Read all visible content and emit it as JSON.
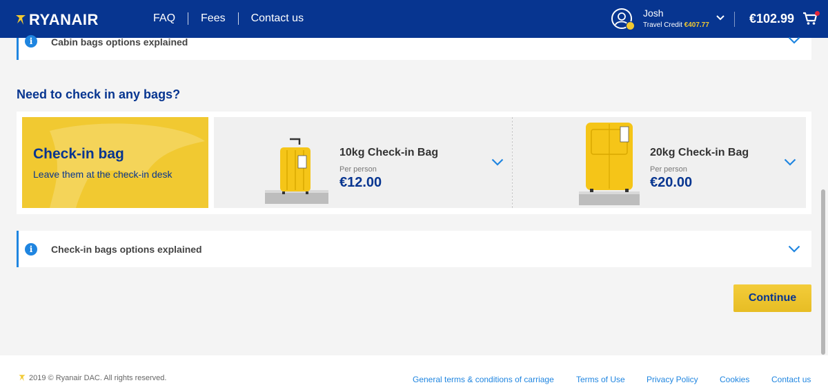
{
  "header": {
    "brand": "RYANAIR",
    "nav": {
      "faq": "FAQ",
      "fees": "Fees",
      "contact": "Contact us"
    },
    "user": {
      "name": "Josh",
      "credit_label": "Travel Credit",
      "credit_amount": "€407.77"
    },
    "total": "€102.99"
  },
  "cabin_panel": {
    "label": "Cabin bags options explained"
  },
  "checkin_section": {
    "title": "Need to check in any bags?",
    "promo": {
      "title": "Check-in bag",
      "subtitle": "Leave them at the check-in desk"
    },
    "options": [
      {
        "name": "10kg Check-in Bag",
        "per": "Per person",
        "price": "€12.00"
      },
      {
        "name": "20kg Check-in Bag",
        "per": "Per person",
        "price": "€20.00"
      }
    ]
  },
  "checkin_panel": {
    "label": "Check-in bags options explained"
  },
  "continue_label": "Continue",
  "footer": {
    "copyright": "2019 © Ryanair DAC. All rights reserved.",
    "links": {
      "terms": "General terms & conditions of carriage",
      "use": "Terms of Use",
      "privacy": "Privacy Policy",
      "cookies": "Cookies",
      "contact": "Contact us"
    }
  },
  "colors": {
    "brand_blue": "#073590",
    "brand_yellow": "#f1c931",
    "accent_blue": "#1f85e0"
  },
  "icons": [
    "harp-logo-icon",
    "avatar-icon",
    "chevron-down-icon",
    "cart-icon",
    "info-icon",
    "suitcase-icon"
  ]
}
